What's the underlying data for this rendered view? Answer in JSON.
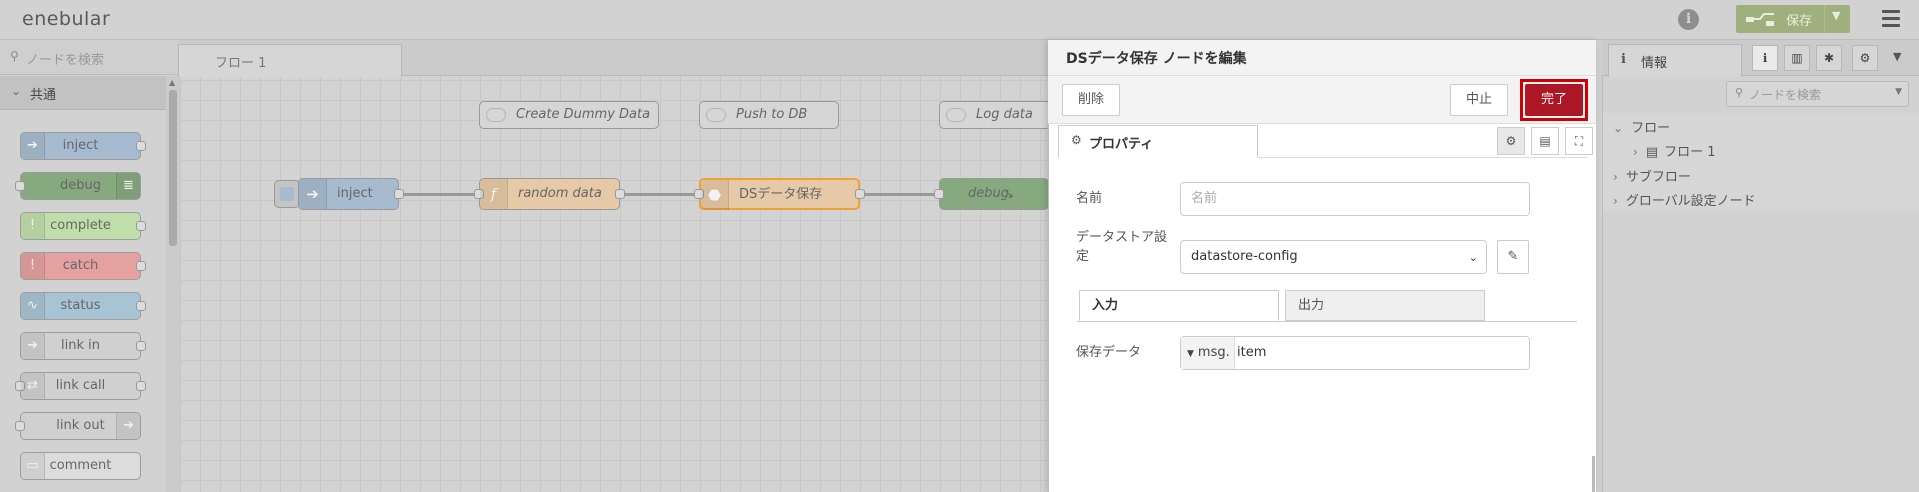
{
  "header": {
    "logo": "enebular",
    "deploy_label": "保存"
  },
  "palette": {
    "search_placeholder": "ノードを検索",
    "category": "共通",
    "nodes": [
      "inject",
      "debug",
      "complete",
      "catch",
      "status",
      "link in",
      "link call",
      "link out",
      "comment"
    ],
    "node_colors": [
      "#a6bbcf",
      "#87a980",
      "#c0deaa",
      "#e5a0a0",
      "#c0deed",
      "#dddddd",
      "#dddddd",
      "#dddddd",
      "#ffffff"
    ]
  },
  "workspace": {
    "tab": "フロー 1",
    "comments": [
      "Create Dummy Data",
      "Push to DB",
      "Log data"
    ],
    "nodes": [
      "inject",
      "random data",
      "DSデータ保存",
      "debug"
    ]
  },
  "tray": {
    "title": "DSデータ保存 ノードを編集",
    "delete_label": "削除",
    "cancel_label": "中止",
    "done_label": "完了",
    "tab_properties": "プロパティ",
    "name_label": "名前",
    "name_placeholder": "名前",
    "datastore_label": "データストア設定",
    "datastore_value": "datastore-config",
    "subtab_input": "入力",
    "subtab_output": "出力",
    "save_data_label": "保存データ",
    "type_prefix": "msg.",
    "type_value": "item"
  },
  "sidebar": {
    "tab_info": "情報",
    "search_placeholder": "ノードを検索",
    "tree": [
      "フロー",
      "フロー 1",
      "サブフロー",
      "グローバル設定ノード"
    ]
  },
  "colors": {
    "done_button": "#ad1625",
    "highlight": "#d10000",
    "deploy": "#9fb07e"
  }
}
